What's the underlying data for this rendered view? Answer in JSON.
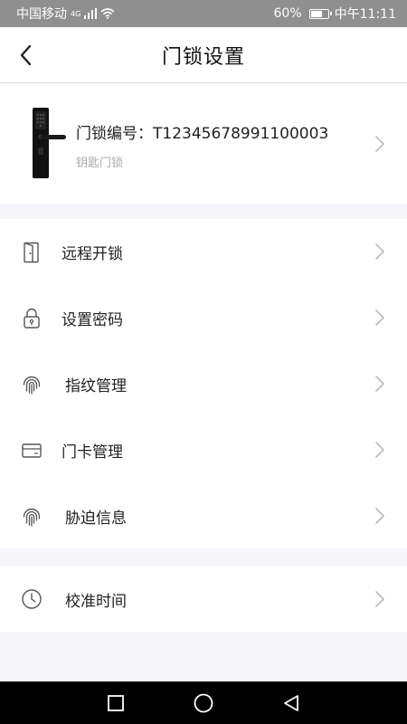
{
  "status_bar": {
    "carrier": "中国移动",
    "network": "4G",
    "battery": "60%",
    "time": "中午11:11"
  },
  "header": {
    "title": "门锁设置"
  },
  "device": {
    "code_label": "门锁编号：T12345678991100003",
    "type": "钥匙门锁"
  },
  "menu": {
    "remote_unlock": "远程开锁",
    "set_password": "设置密码",
    "fingerprint": "指纹管理",
    "door_card": "门卡管理",
    "duress": "胁迫信息",
    "calibrate_time": "校准时间"
  }
}
